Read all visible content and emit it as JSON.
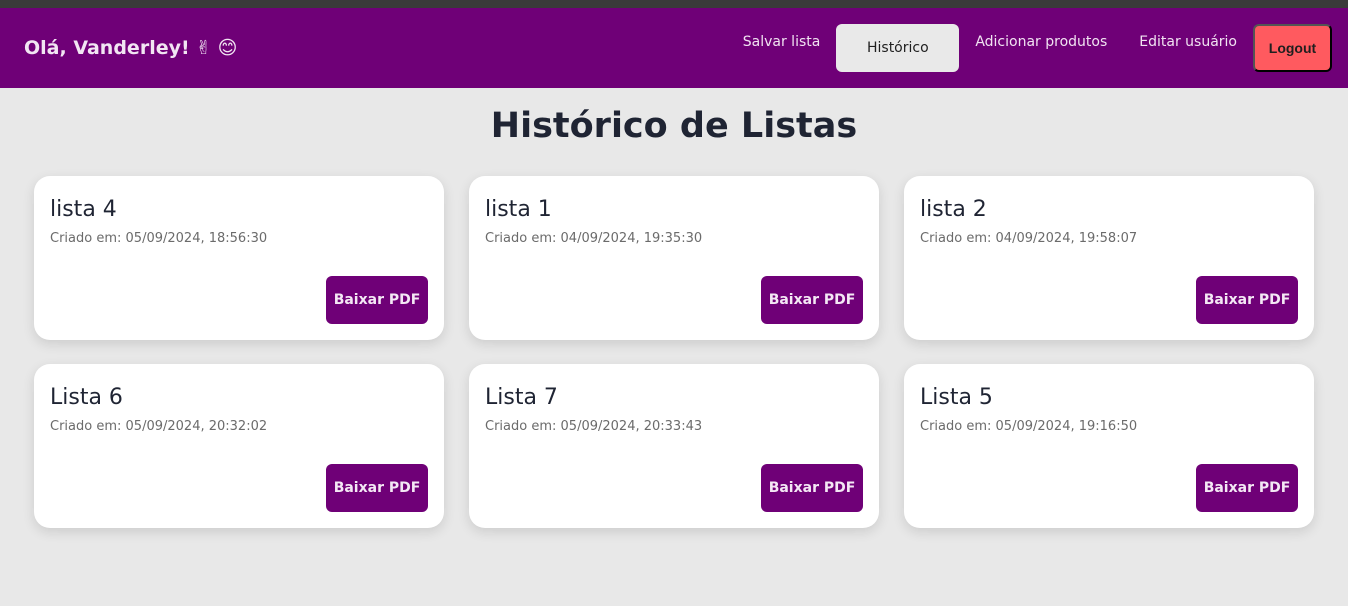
{
  "header": {
    "greeting": "Olá, Vanderley!",
    "emojis": [
      "✌",
      "😊"
    ],
    "nav": {
      "save_list": "Salvar lista",
      "history": "Histórico",
      "add_products": "Adicionar produtos",
      "edit_user": "Editar usuário",
      "logout": "Logout"
    }
  },
  "main": {
    "title": "Histórico de Listas",
    "download_label": "Baixar PDF",
    "created_prefix": "Criado em:",
    "lists": [
      {
        "name": "lista 4",
        "created": "05/09/2024, 18:56:30"
      },
      {
        "name": "lista 1",
        "created": "04/09/2024, 19:35:30"
      },
      {
        "name": "lista 2",
        "created": "04/09/2024, 19:58:07"
      },
      {
        "name": "Lista 6",
        "created": "05/09/2024, 20:32:02"
      },
      {
        "name": "Lista 7",
        "created": "05/09/2024, 20:33:43"
      },
      {
        "name": "Lista 5",
        "created": "05/09/2024, 19:16:50"
      }
    ]
  },
  "colors": {
    "navbar": "#6f0077",
    "logout": "#ff5a5f",
    "button": "#6f0077",
    "background": "#e8e8e8"
  }
}
